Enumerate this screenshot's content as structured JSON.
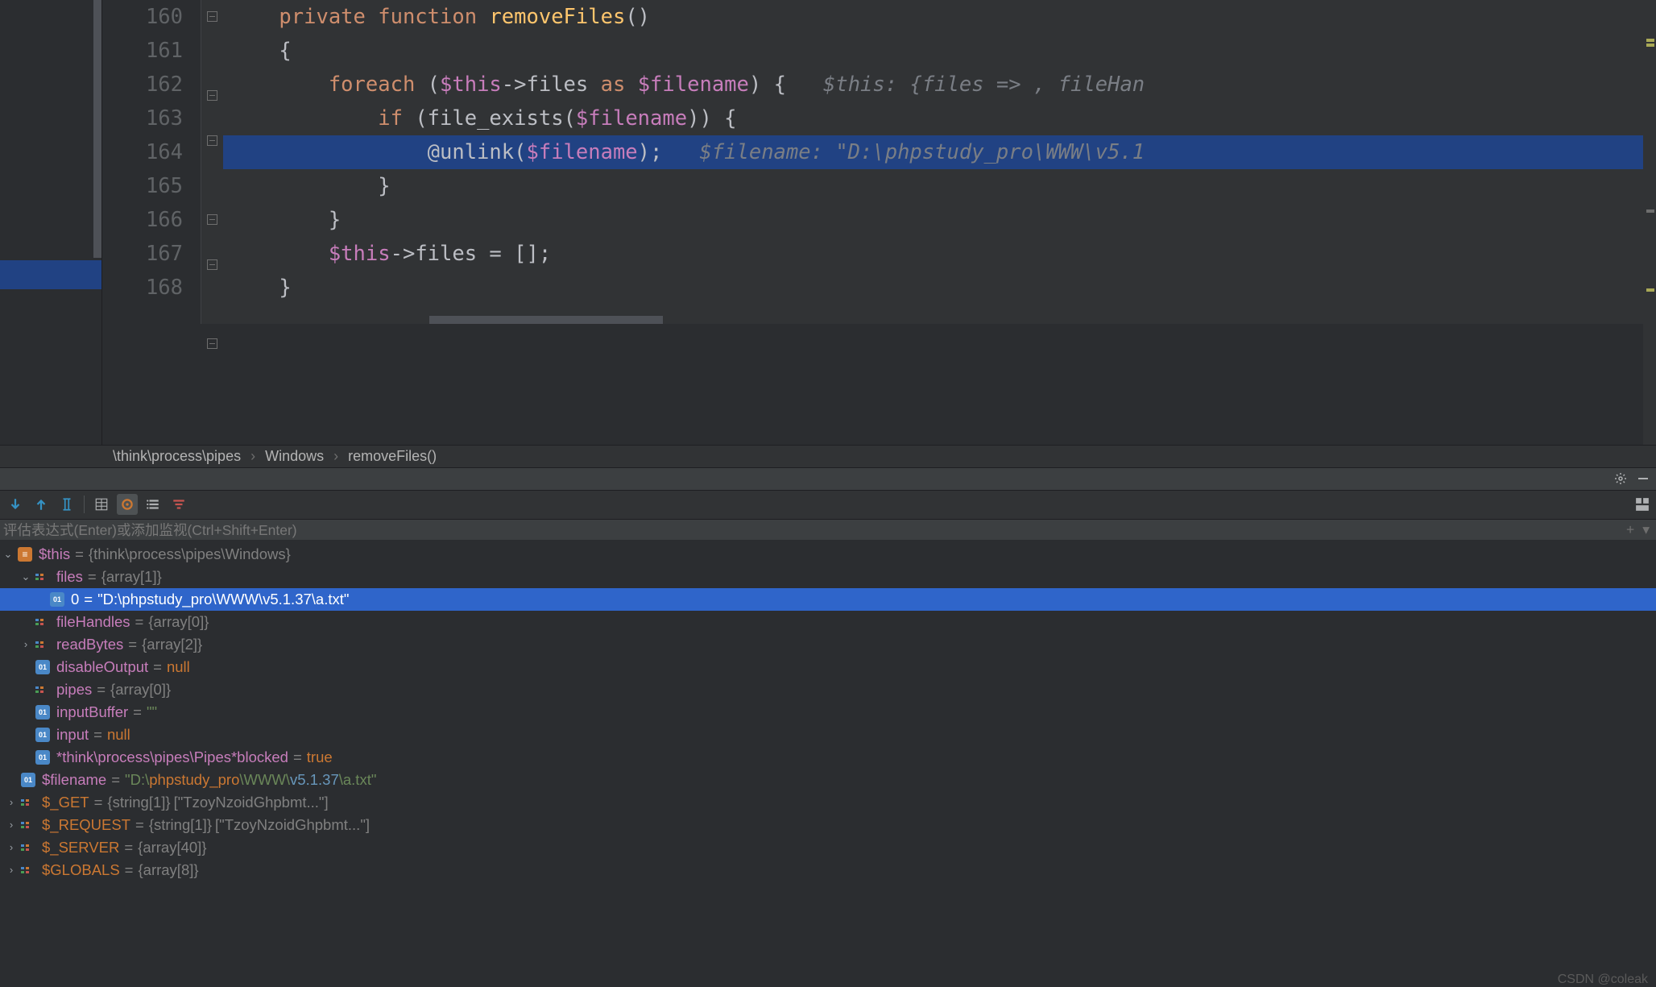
{
  "line_numbers": [
    "160",
    "161",
    "162",
    "163",
    "164",
    "165",
    "166",
    "167",
    "168"
  ],
  "code": {
    "l160": {
      "kw1": "private",
      "kw2": "function",
      "fn": "removeFiles",
      "p": "()"
    },
    "l161": "{",
    "l162": {
      "kw": "foreach",
      "p1": "(",
      "v1": "$this",
      "op": "->",
      "prop": "files",
      "kw2": "as",
      "v2": "$filename",
      "p2": ") {",
      "hint": "$this: {files => , fileHan"
    },
    "l163": {
      "kw": "if",
      "p1": "(",
      "fn": "file_exists",
      "p2": "(",
      "v": "$filename",
      "p3": ")) {"
    },
    "l164": {
      "at": "@",
      "fn": "unlink",
      "p1": "(",
      "v": "$filename",
      "p2": ");",
      "hint": "$filename: \"D:\\phpstudy_pro\\WWW\\v5.1"
    },
    "l165": "}",
    "l166": "}",
    "l167": {
      "v": "$this",
      "op": "->",
      "prop": "files",
      "rest": " = [];"
    },
    "l168": "}"
  },
  "breadcrumb": [
    "\\think\\process\\pipes",
    "Windows",
    "removeFiles()"
  ],
  "eval_placeholder": "评估表达式(Enter)或添加监视(Ctrl+Shift+Enter)",
  "vars": {
    "this": {
      "name": "$this",
      "value": "{think\\process\\pipes\\Windows}"
    },
    "files": {
      "name": "files",
      "value": "{array[1]}"
    },
    "files0": {
      "name": "0",
      "value": "\"D:\\phpstudy_pro\\WWW\\v5.1.37\\a.txt\""
    },
    "fileHandles": {
      "name": "fileHandles",
      "value": "{array[0]}"
    },
    "readBytes": {
      "name": "readBytes",
      "value": "{array[2]}"
    },
    "disableOutput": {
      "name": "disableOutput",
      "value": "null"
    },
    "pipes": {
      "name": "pipes",
      "value": "{array[0]}"
    },
    "inputBuffer": {
      "name": "inputBuffer",
      "value": "\"\""
    },
    "input": {
      "name": "input",
      "value": "null"
    },
    "blocked": {
      "name": "*think\\process\\pipes\\Pipes*blocked",
      "value": "true"
    },
    "filename": {
      "name": "$filename",
      "d": "\"D:\\",
      "p": "phpstudy_pro",
      "w": "\\WWW\\",
      "v": "v5.1.37",
      "a": "\\a.txt\""
    },
    "get": {
      "name": "$_GET",
      "value": "{string[1]}",
      "extra": "[\"TzoyNzoidGhpbmt...\"]"
    },
    "request": {
      "name": "$_REQUEST",
      "value": "{string[1]}",
      "extra": "[\"TzoyNzoidGhpbmt...\"]"
    },
    "server": {
      "name": "$_SERVER",
      "value": "{array[40]}"
    },
    "globals": {
      "name": "$GLOBALS",
      "value": "{array[8]}"
    }
  },
  "watermark": "CSDN @coleak"
}
